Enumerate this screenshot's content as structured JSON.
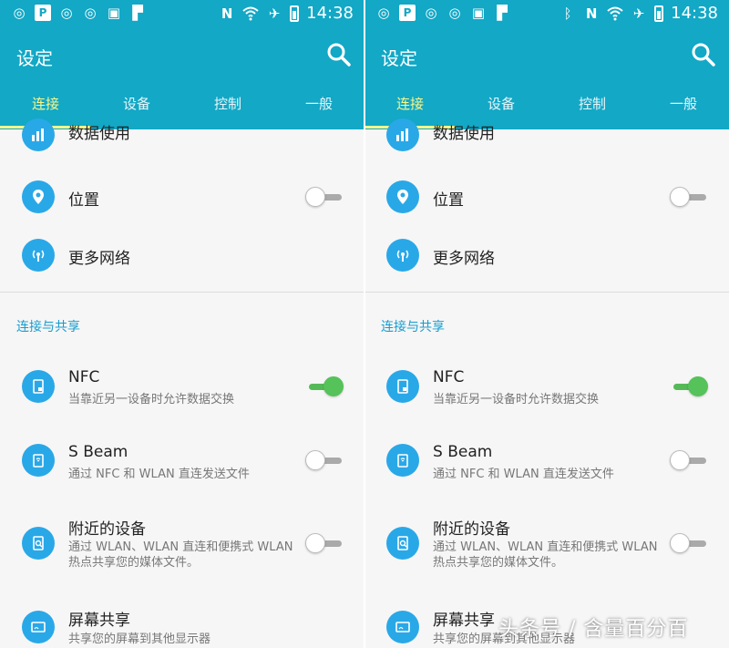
{
  "colors": {
    "accent": "#12a8c6",
    "tab_active": "#f9f68a",
    "icon_bg": "#29a8e8",
    "section_header": "#169ccf",
    "toggle_on": "#56b957"
  },
  "status_bar": {
    "left_icons": [
      "weibo-icon",
      "p-app-icon",
      "weibo-icon",
      "weibo-icon",
      "image-icon",
      "flipboard-icon"
    ],
    "right_icons_left_panel": [
      "nfc-n-icon",
      "wifi-icon",
      "airplane-icon",
      "battery-icon"
    ],
    "right_icons_right_panel": [
      "bluetooth-icon",
      "nfc-n-icon",
      "wifi-icon",
      "airplane-icon",
      "battery-icon"
    ],
    "time": "14:38"
  },
  "app": {
    "title": "设定"
  },
  "tabs": [
    {
      "label": "连接",
      "active": true
    },
    {
      "label": "设备",
      "active": false
    },
    {
      "label": "控制",
      "active": false
    },
    {
      "label": "一般",
      "active": false
    }
  ],
  "items_top": [
    {
      "title": "数据使用",
      "icon": "bar-chart-icon"
    },
    {
      "title": "位置",
      "icon": "location-pin-icon",
      "toggle": "off"
    },
    {
      "title": "更多网络",
      "icon": "antenna-icon"
    }
  ],
  "section": {
    "header": "连接与共享"
  },
  "items_section": [
    {
      "title": "NFC",
      "subtitle": "当靠近另一设备时允许数据交换",
      "icon": "nfc-device-icon",
      "toggle": "on"
    },
    {
      "title": "S Beam",
      "subtitle": "通过 NFC 和 WLAN 直连发送文件",
      "icon": "s-beam-icon",
      "toggle": "off"
    },
    {
      "title": "附近的设备",
      "subtitle": "通过 WLAN、WLAN 直连和便携式 WLAN 热点共享您的媒体文件。",
      "icon": "nearby-device-icon",
      "toggle": "off"
    },
    {
      "title": "屏幕共享",
      "subtitle": "共享您的屏幕到其他显示器",
      "icon": "screen-share-icon"
    }
  ],
  "watermark": "头条号 / 含量百分百"
}
